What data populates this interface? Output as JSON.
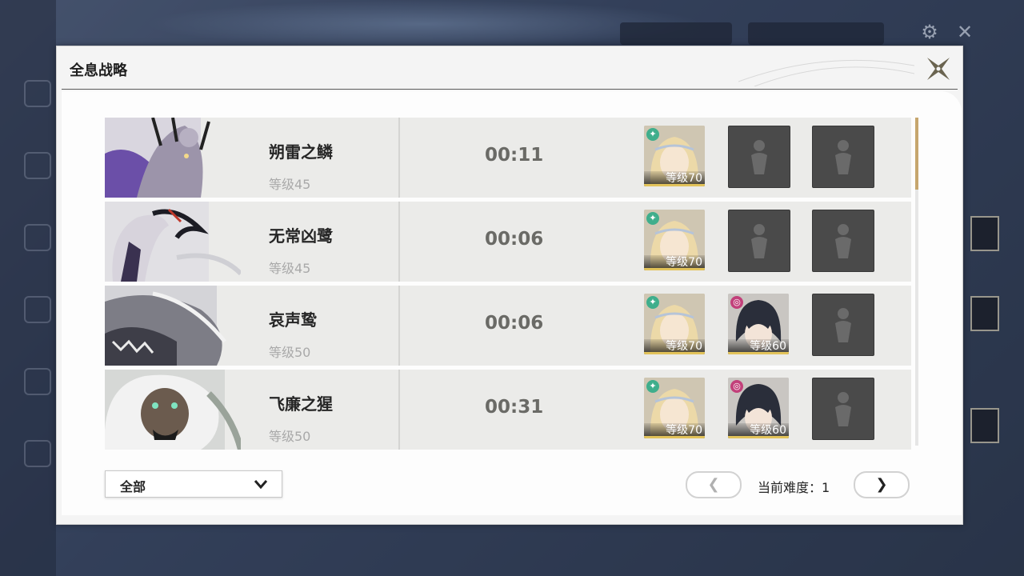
{
  "dialog": {
    "title": "全息战略",
    "close_icon": "close-x-icon"
  },
  "bosses": [
    {
      "name": "朔雷之鳞",
      "level": "等级45",
      "time": "00:11",
      "party": [
        {
          "type": "char",
          "level": "等级70",
          "element": "aero",
          "element_color": "#3fae8c"
        },
        {
          "type": "empty"
        },
        {
          "type": "empty"
        }
      ]
    },
    {
      "name": "无常凶鹭",
      "level": "等级45",
      "time": "00:06",
      "party": [
        {
          "type": "char",
          "level": "等级70",
          "element": "aero",
          "element_color": "#3fae8c"
        },
        {
          "type": "empty"
        },
        {
          "type": "empty"
        }
      ]
    },
    {
      "name": "哀声鸷",
      "level": "等级50",
      "time": "00:06",
      "party": [
        {
          "type": "char",
          "level": "等级70",
          "element": "aero",
          "element_color": "#3fae8c"
        },
        {
          "type": "char",
          "level": "等级60",
          "element": "havoc",
          "element_color": "#c2407a"
        },
        {
          "type": "empty"
        }
      ]
    },
    {
      "name": "飞廉之猩",
      "level": "等级50",
      "time": "00:31",
      "party": [
        {
          "type": "char",
          "level": "等级70",
          "element": "aero",
          "element_color": "#3fae8c"
        },
        {
          "type": "char",
          "level": "等级60",
          "element": "havoc",
          "element_color": "#c2407a"
        },
        {
          "type": "empty"
        }
      ]
    }
  ],
  "filter": {
    "selected": "全部",
    "icon": "chevron-down-icon"
  },
  "pager": {
    "prev_label": "❮",
    "next_label": "❯",
    "difficulty_label": "当前难度：",
    "difficulty_value": "1"
  },
  "colors": {
    "accent_gold": "#c6a66e",
    "row_bg": "#ebebe9",
    "empty_slot": "#4a4a4a"
  }
}
